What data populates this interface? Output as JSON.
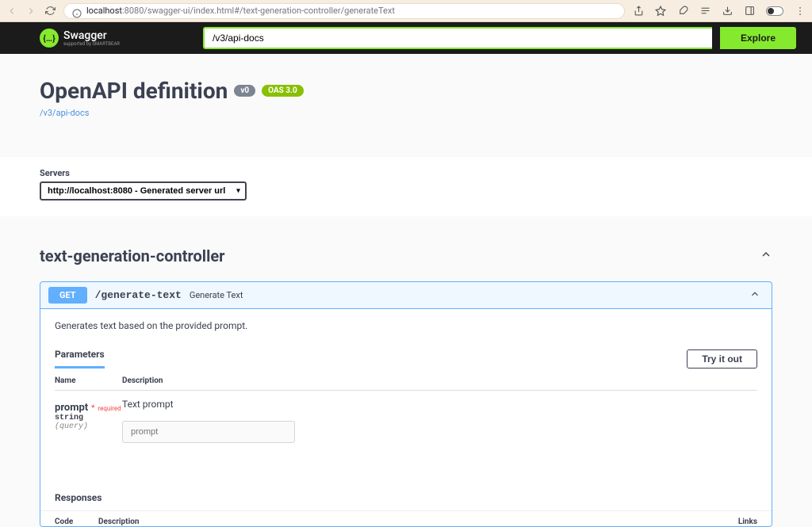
{
  "browser": {
    "url_domain": "localhost",
    "url_path": ":8080/swagger-ui/index.html#/text-generation-controller/generateText"
  },
  "swagger": {
    "brand": "Swagger",
    "brand_sub": "supported by SMARTBEAR",
    "spec_url": "/v3/api-docs",
    "explore_btn": "Explore"
  },
  "info": {
    "title": "OpenAPI definition",
    "version": "v0",
    "oas": "OAS 3.0",
    "link": "/v3/api-docs"
  },
  "servers": {
    "label": "Servers",
    "selected": "http://localhost:8080 - Generated server url"
  },
  "tag": {
    "name": "text-generation-controller"
  },
  "operation": {
    "method": "GET",
    "path": "/generate-text",
    "summary": "Generate Text",
    "description": "Generates text based on the provided prompt.",
    "params_label": "Parameters",
    "try_it": "Try it out",
    "col_name": "Name",
    "col_desc": "Description",
    "param": {
      "name": "prompt",
      "required": "required",
      "type": "string",
      "in": "(query)",
      "desc": "Text prompt",
      "placeholder": "prompt"
    },
    "responses_label": "Responses",
    "resp_code": "Code",
    "resp_desc": "Description",
    "resp_links": "Links"
  }
}
